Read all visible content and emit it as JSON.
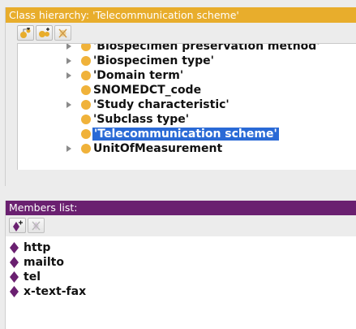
{
  "class_hierarchy": {
    "title": "Class hierarchy: 'Telecommunication scheme'",
    "toolbar": [
      "add-subclass-icon",
      "add-sibling-class-icon",
      "delete-class-icon"
    ],
    "items": [
      {
        "label": "'Biospecimen preservation method'",
        "expandable": true,
        "selected": false
      },
      {
        "label": "'Biospecimen type'",
        "expandable": true,
        "selected": false
      },
      {
        "label": "'Domain term'",
        "expandable": true,
        "selected": false
      },
      {
        "label": "SNOMEDCT_code",
        "expandable": false,
        "selected": false
      },
      {
        "label": "'Study characteristic'",
        "expandable": true,
        "selected": false
      },
      {
        "label": "'Subclass type'",
        "expandable": false,
        "selected": false
      },
      {
        "label": "'Telecommunication scheme'",
        "expandable": false,
        "selected": true
      },
      {
        "label": "UnitOfMeasurement",
        "expandable": true,
        "selected": false
      }
    ]
  },
  "members_list": {
    "title": "Members list:",
    "toolbar": [
      "add-individual-icon",
      "delete-individual-icon"
    ],
    "items": [
      "http",
      "mailto",
      "tel",
      "x-text-fax"
    ]
  },
  "colors": {
    "class_header": "#e8ad2c",
    "members_header": "#6a2070",
    "class_dot": "#f0b23a",
    "individual_diamond": "#6a2070",
    "selection": "#2a6ad6"
  }
}
